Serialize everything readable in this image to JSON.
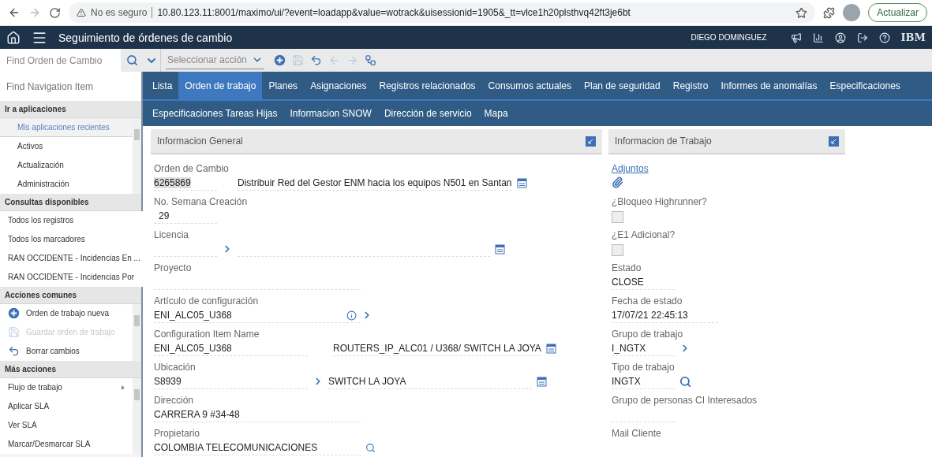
{
  "browser": {
    "security": "No es seguro",
    "url": "10.80.123.11:8001/maximo/ui/?event=loadapp&value=wotrack&uisessionid=1905&_tt=vlce1h20plsthvq42ft3je6bt",
    "update_button": "Actualizar"
  },
  "header": {
    "title": "Seguimiento de órdenes de cambio",
    "user": "DIEGO DOMINGUEZ",
    "brand": "IBM"
  },
  "toolbar": {
    "search": {
      "placeholder": "Find Orden de Cambio"
    },
    "action_select": {
      "placeholder": "Seleccionar acción"
    },
    "actions": [
      {
        "kind": "new",
        "disabled": false
      },
      {
        "kind": "save",
        "disabled": true
      },
      {
        "kind": "undo",
        "disabled": false
      },
      {
        "kind": "previous",
        "disabled": true
      },
      {
        "kind": "next",
        "disabled": true
      },
      {
        "kind": "workflow",
        "disabled": false
      }
    ]
  },
  "sidebar": {
    "search": {
      "placeholder": "Find Navigation Item"
    },
    "sections": [
      {
        "title": "Ir a aplicaciones",
        "items": [
          {
            "label": "Mis aplicaciones recientes",
            "selected": true
          },
          {
            "label": "Activos",
            "selected": false
          },
          {
            "label": "Actualización",
            "selected": false
          },
          {
            "label": "Administración",
            "selected": false
          }
        ]
      },
      {
        "title": "Consultas disponibles",
        "items": [
          {
            "label": "Todos los registros",
            "selected": false
          },
          {
            "label": "Todos los marcadores",
            "selected": false
          },
          {
            "label": "RAN OCCIDENTE - Incidencias En ...",
            "selected": false
          },
          {
            "label": "RAN OCCIDENTE - Incidencias Por",
            "selected": false
          }
        ]
      },
      {
        "title": "Acciones comunes",
        "items": [
          {
            "label": "Orden de trabajo nueva",
            "kind": "new",
            "disabled": false
          },
          {
            "label": "Guardar orden de trabajo",
            "kind": "save",
            "disabled": true
          },
          {
            "label": "Borrar cambios",
            "kind": "undo",
            "disabled": false
          }
        ]
      },
      {
        "title": "Más acciones",
        "items": [
          {
            "label": "Flujo de trabajo",
            "submenu": true
          },
          {
            "label": "Aplicar SLA",
            "submenu": false
          },
          {
            "label": "Ver SLA",
            "submenu": false
          },
          {
            "label": "Marcar/Desmarcar SLA",
            "submenu": false
          }
        ]
      }
    ]
  },
  "tab_rows": [
    [
      {
        "label": "Lista",
        "selected": false
      },
      {
        "label": "Orden de trabajo",
        "selected": true
      },
      {
        "label": "Planes",
        "selected": false
      },
      {
        "label": "Asignaciones",
        "selected": false
      },
      {
        "label": "Registros relacionados",
        "selected": false
      },
      {
        "label": "Consumos actuales",
        "selected": false
      },
      {
        "label": "Plan de seguridad",
        "selected": false
      },
      {
        "label": "Registro",
        "selected": false
      },
      {
        "label": "Informes de anomalías",
        "selected": false
      },
      {
        "label": "Especificaciones",
        "selected": false
      }
    ],
    [
      {
        "label": "Especificaciones Tareas Hijas",
        "selected": false
      },
      {
        "label": "Informacion SNOW",
        "selected": false
      },
      {
        "label": "Dirección de servicio",
        "selected": false
      },
      {
        "label": "Mapa",
        "selected": false
      }
    ]
  ],
  "panels": [
    {
      "title": "Informacion General",
      "fields": [
        {
          "kind": "code_desc",
          "label": "Orden de Cambio",
          "value": "6265869",
          "description": "Distribuir Red del Gestor ENM hacia los equipos N501 en Santan"
        },
        {
          "kind": "short",
          "label": "No. Semana Creación",
          "value": "29"
        },
        {
          "kind": "lookup_desc",
          "label": "Licencia"
        },
        {
          "kind": "long",
          "label": "Proyecto"
        },
        {
          "kind": "info_lookup",
          "label": "Artículo de configuración",
          "value": "ENI_ALC05_U368"
        },
        {
          "kind": "pair_desc",
          "label": "Configuration Item Name",
          "value": "ENI_ALC05_U368",
          "description": "ROUTERS_IP_ALC01 / U368/ SWITCH LA JOYA"
        },
        {
          "kind": "lookup_pair",
          "label": "Ubicación",
          "value": "S8939",
          "description": "SWITCH LA JOYA"
        },
        {
          "kind": "long",
          "label": "Dirección",
          "value": "CARRERA 9 #34-48"
        },
        {
          "kind": "search_long",
          "label": "Propietario",
          "value": "COLOMBIA TELECOMUNICACIONES"
        }
      ]
    },
    {
      "title": "Informacion de Trabajo",
      "fields": [
        {
          "kind": "attachments",
          "label": "Adjuntos"
        },
        {
          "kind": "checkbox",
          "label": "¿Bloqueo Highrunner?",
          "checked": false
        },
        {
          "kind": "checkbox",
          "label": "¿E1 Adicional?",
          "checked": false
        },
        {
          "kind": "short",
          "label": "Estado",
          "value": "CLOSE"
        },
        {
          "kind": "medium",
          "label": "Fecha de estado",
          "value": "17/07/21 22:45:13"
        },
        {
          "kind": "lookup",
          "label": "Grupo de trabajo",
          "value": "I_NGTX"
        },
        {
          "kind": "search",
          "label": "Tipo de trabajo",
          "value": "INGTX"
        },
        {
          "kind": "short",
          "label": "Grupo de personas CI Interesados"
        },
        {
          "kind": "label_only",
          "label": "Mail Cliente"
        }
      ]
    }
  ]
}
